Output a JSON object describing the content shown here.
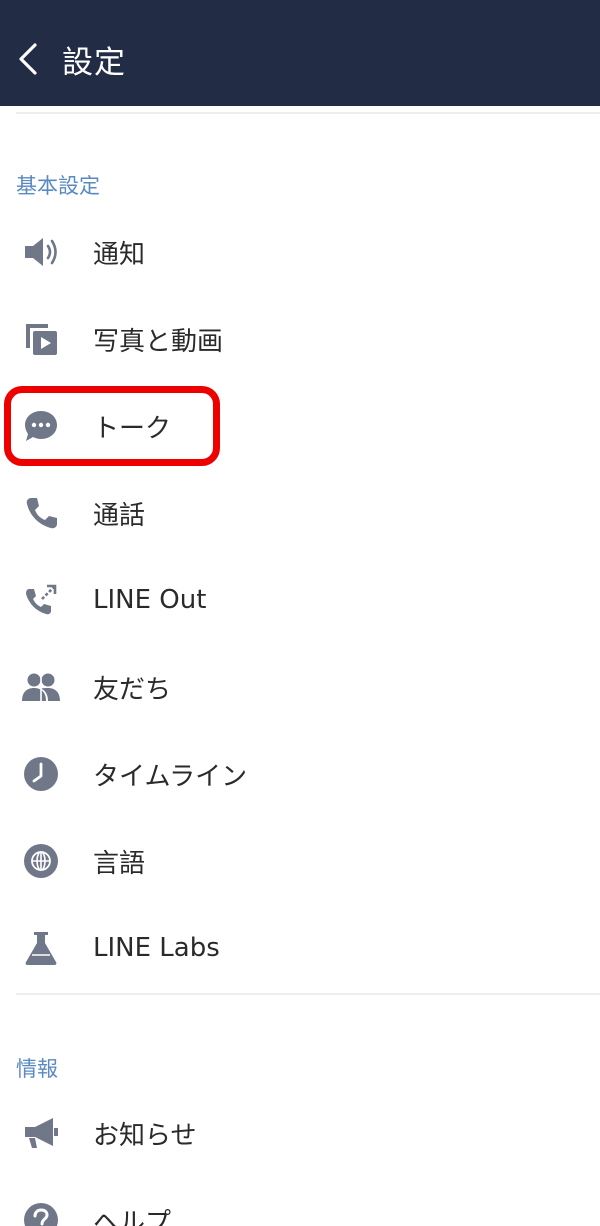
{
  "header": {
    "title": "設定",
    "back_icon": "chevron-left-icon",
    "background_color": "#232c45"
  },
  "sections": [
    {
      "title": "基本設定",
      "items": [
        {
          "label": "通知",
          "icon": "speaker-icon"
        },
        {
          "label": "写真と動画",
          "icon": "photo-video-icon"
        },
        {
          "label": "トーク",
          "icon": "chat-bubble-icon"
        },
        {
          "label": "通話",
          "icon": "phone-icon"
        },
        {
          "label": "LINE Out",
          "icon": "phone-out-icon"
        },
        {
          "label": "友だち",
          "icon": "friends-icon"
        },
        {
          "label": "タイムライン",
          "icon": "clock-icon"
        },
        {
          "label": "言語",
          "icon": "globe-icon"
        },
        {
          "label": "LINE Labs",
          "icon": "flask-icon"
        }
      ]
    },
    {
      "title": "情報",
      "items": [
        {
          "label": "お知らせ",
          "icon": "megaphone-icon"
        },
        {
          "label": "ヘルプ",
          "icon": "help-icon"
        }
      ]
    }
  ],
  "colors": {
    "accent_section": "#5a8ac0",
    "icon": "#6f7789",
    "highlight": "#ee0000"
  }
}
